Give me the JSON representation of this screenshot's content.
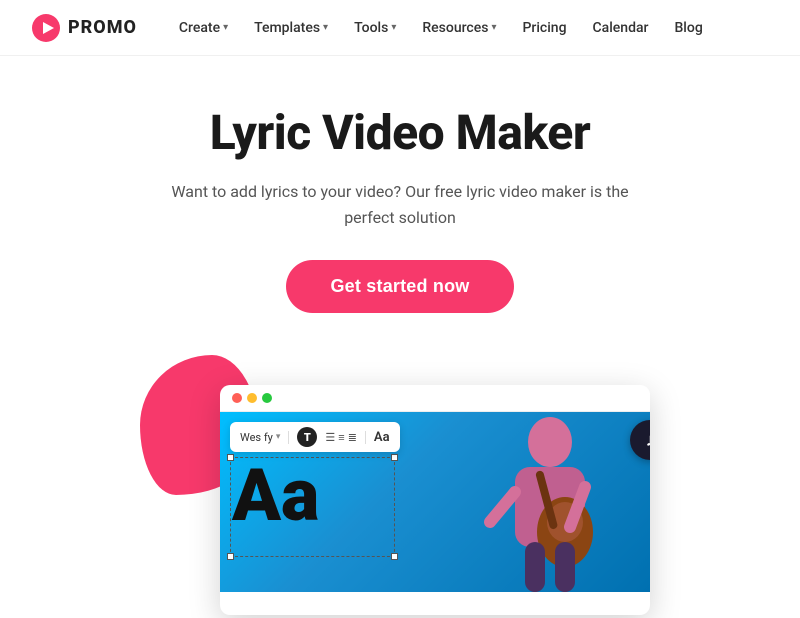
{
  "nav": {
    "logo_text": "PROMO",
    "items": [
      {
        "label": "Create",
        "has_dropdown": true
      },
      {
        "label": "Templates",
        "has_dropdown": true
      },
      {
        "label": "Tools",
        "has_dropdown": true
      },
      {
        "label": "Resources",
        "has_dropdown": true
      },
      {
        "label": "Pricing",
        "has_dropdown": false
      },
      {
        "label": "Calendar",
        "has_dropdown": false
      },
      {
        "label": "Blog",
        "has_dropdown": false
      }
    ]
  },
  "hero": {
    "title": "Lyric Video Maker",
    "subtitle": "Want to add lyrics to your video? Our free lyric video maker is the perfect solution",
    "cta_label": "Get started now"
  },
  "editor": {
    "font_name": "Wes fy",
    "bold_label": "T",
    "aa_label": "Aa",
    "big_aa": "Aa",
    "music_icon": "♪"
  },
  "colors": {
    "accent": "#f7396b",
    "dark": "#1a1a2e"
  }
}
